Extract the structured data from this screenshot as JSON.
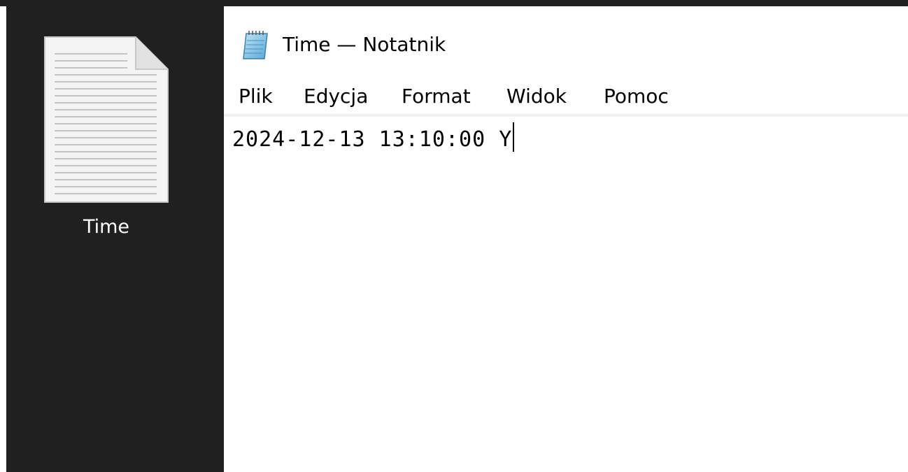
{
  "desktop": {
    "icon_label": "Time",
    "icon_name": "text-file-icon"
  },
  "window": {
    "title": "Time — Notatnik",
    "app_icon": "notepad-icon"
  },
  "menu": {
    "items": [
      {
        "label": "Plik"
      },
      {
        "label": "Edycja"
      },
      {
        "label": "Format"
      },
      {
        "label": "Widok"
      },
      {
        "label": "Pomoc"
      }
    ]
  },
  "editor": {
    "content": "2024-12-13 13:10:00 Y"
  },
  "colors": {
    "desktop_bg": "#202020",
    "window_bg": "#ffffff",
    "text": "#000000"
  }
}
